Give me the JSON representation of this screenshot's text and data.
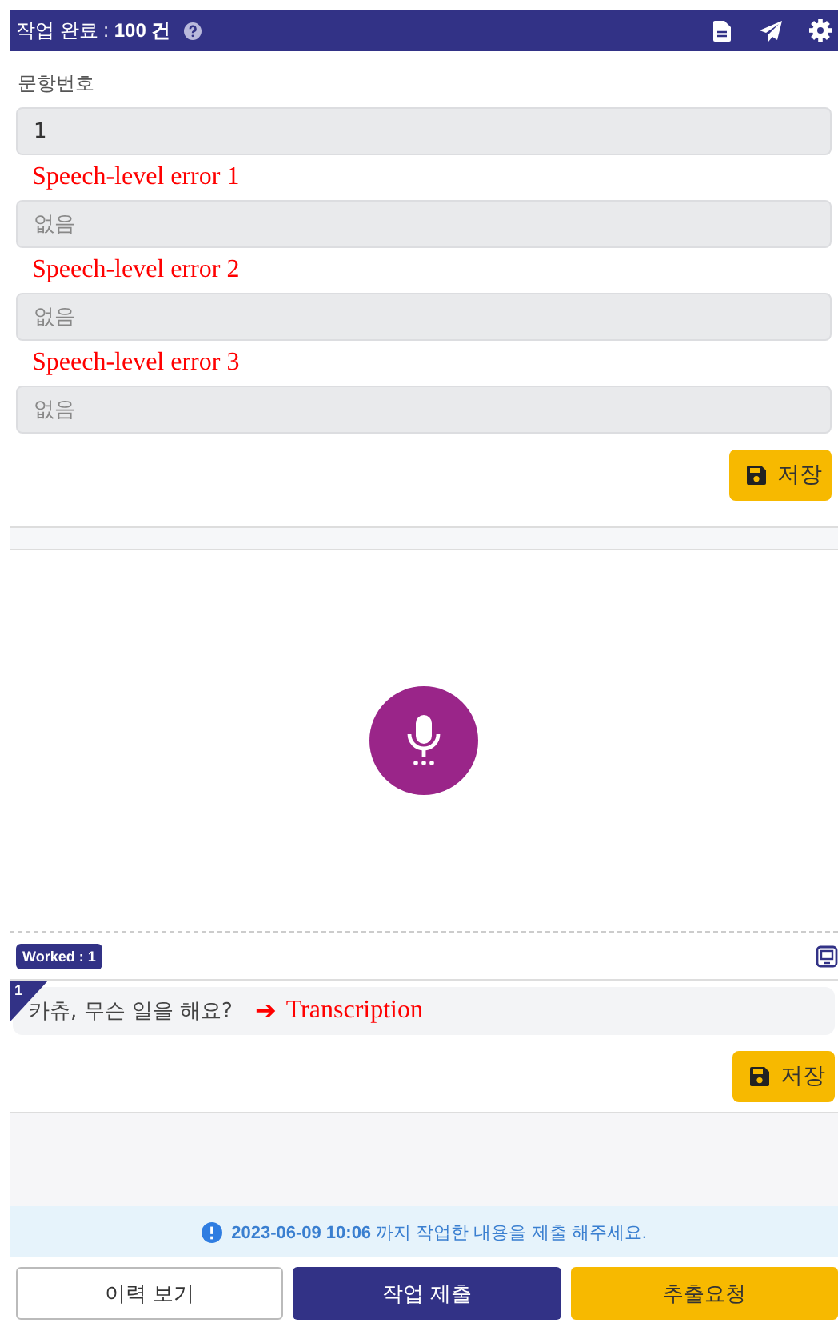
{
  "header": {
    "title": "작업 완료 : **100 건**"
  },
  "form": {
    "label": "문항번호",
    "number_field": {
      "value": "1"
    },
    "error_fields": [
      {
        "annotation": "Speech-level error 1",
        "placeholder": "없음"
      },
      {
        "annotation": "Speech-level error 2",
        "placeholder": "없음"
      },
      {
        "annotation": "Speech-level error 3",
        "placeholder": "없음"
      }
    ],
    "save_button": "저장"
  },
  "worked_badge": "Worked : 1",
  "transcription": {
    "index": "1",
    "text": "카츄, 무슨 일을 해요?",
    "arrow": "➔",
    "annotation": "Transcription"
  },
  "save_button": "저장",
  "notice": "**2023-06-09 10:06** 까지 작업한 내용을 제출 해주세요.",
  "buttons": [
    {
      "label": "이력 보기",
      "kind": "outline"
    },
    {
      "label": "작업 제출",
      "kind": "primary"
    },
    {
      "label": "추출요청",
      "kind": "warning"
    }
  ]
}
